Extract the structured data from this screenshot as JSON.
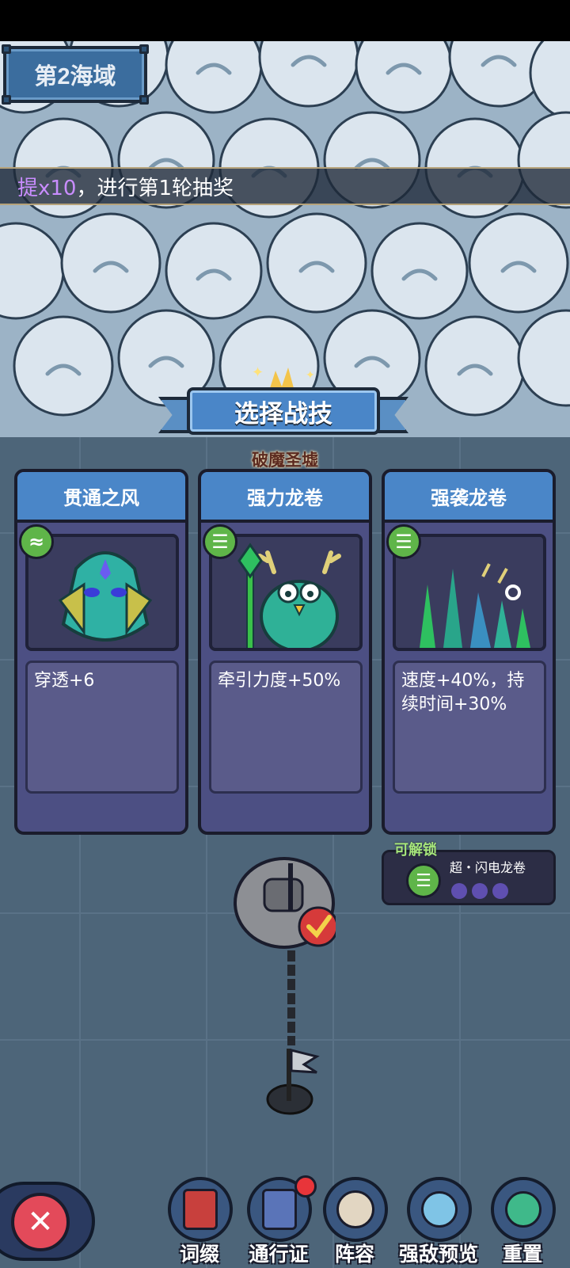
{
  "region": {
    "title": "第2海域"
  },
  "ticker": {
    "highlight": "提x10",
    "text": "，进行第1轮抽奖"
  },
  "dialog": {
    "title": "选择战技",
    "subtitle": "破魔圣墟",
    "cards": [
      {
        "name": "贯通之风",
        "effect": "穿透+6",
        "type_icon": "wind-icon"
      },
      {
        "name": "强力龙卷",
        "effect": "牵引力度+50%",
        "type_icon": "tornado-icon"
      },
      {
        "name": "强袭龙卷",
        "effect": "速度+40%，持续时间+30%",
        "type_icon": "tornado-icon"
      }
    ]
  },
  "unlock": {
    "label": "可解锁",
    "skill_name": "超・闪电龙卷",
    "pips": 3
  },
  "bottom_nav": [
    {
      "label": "词缀"
    },
    {
      "label": "通行证"
    },
    {
      "label": "阵容"
    },
    {
      "label": "强敌预览"
    },
    {
      "label": "重置"
    }
  ],
  "colors": {
    "card_header": "#4a86c8",
    "card_body": "#4c4f83",
    "type_badge": "#5fb549",
    "accent_purple": "#c98dff",
    "close_red": "#e34a5a"
  }
}
